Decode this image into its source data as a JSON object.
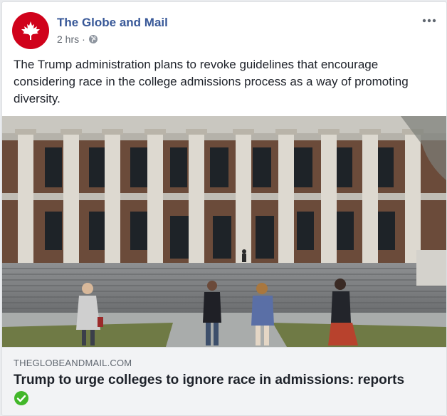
{
  "post": {
    "page_name": "The Globe and Mail",
    "time": "2 hrs",
    "separator": "·",
    "text": "The Trump administration plans to revoke guidelines that encourage considering race in the college admissions process as a way of promoting diversity."
  },
  "icons": {
    "avatar": "maple-leaf-icon",
    "privacy": "globe-icon",
    "more": "more-options-icon",
    "verified": "check-circle-icon"
  },
  "link": {
    "domain": "THEGLOBEANDMAIL.COM",
    "headline": "Trump to urge colleges to ignore race in admissions: reports"
  },
  "colors": {
    "brand_red": "#d0021b",
    "link_blue": "#385898",
    "verified_green": "#42b72a"
  }
}
